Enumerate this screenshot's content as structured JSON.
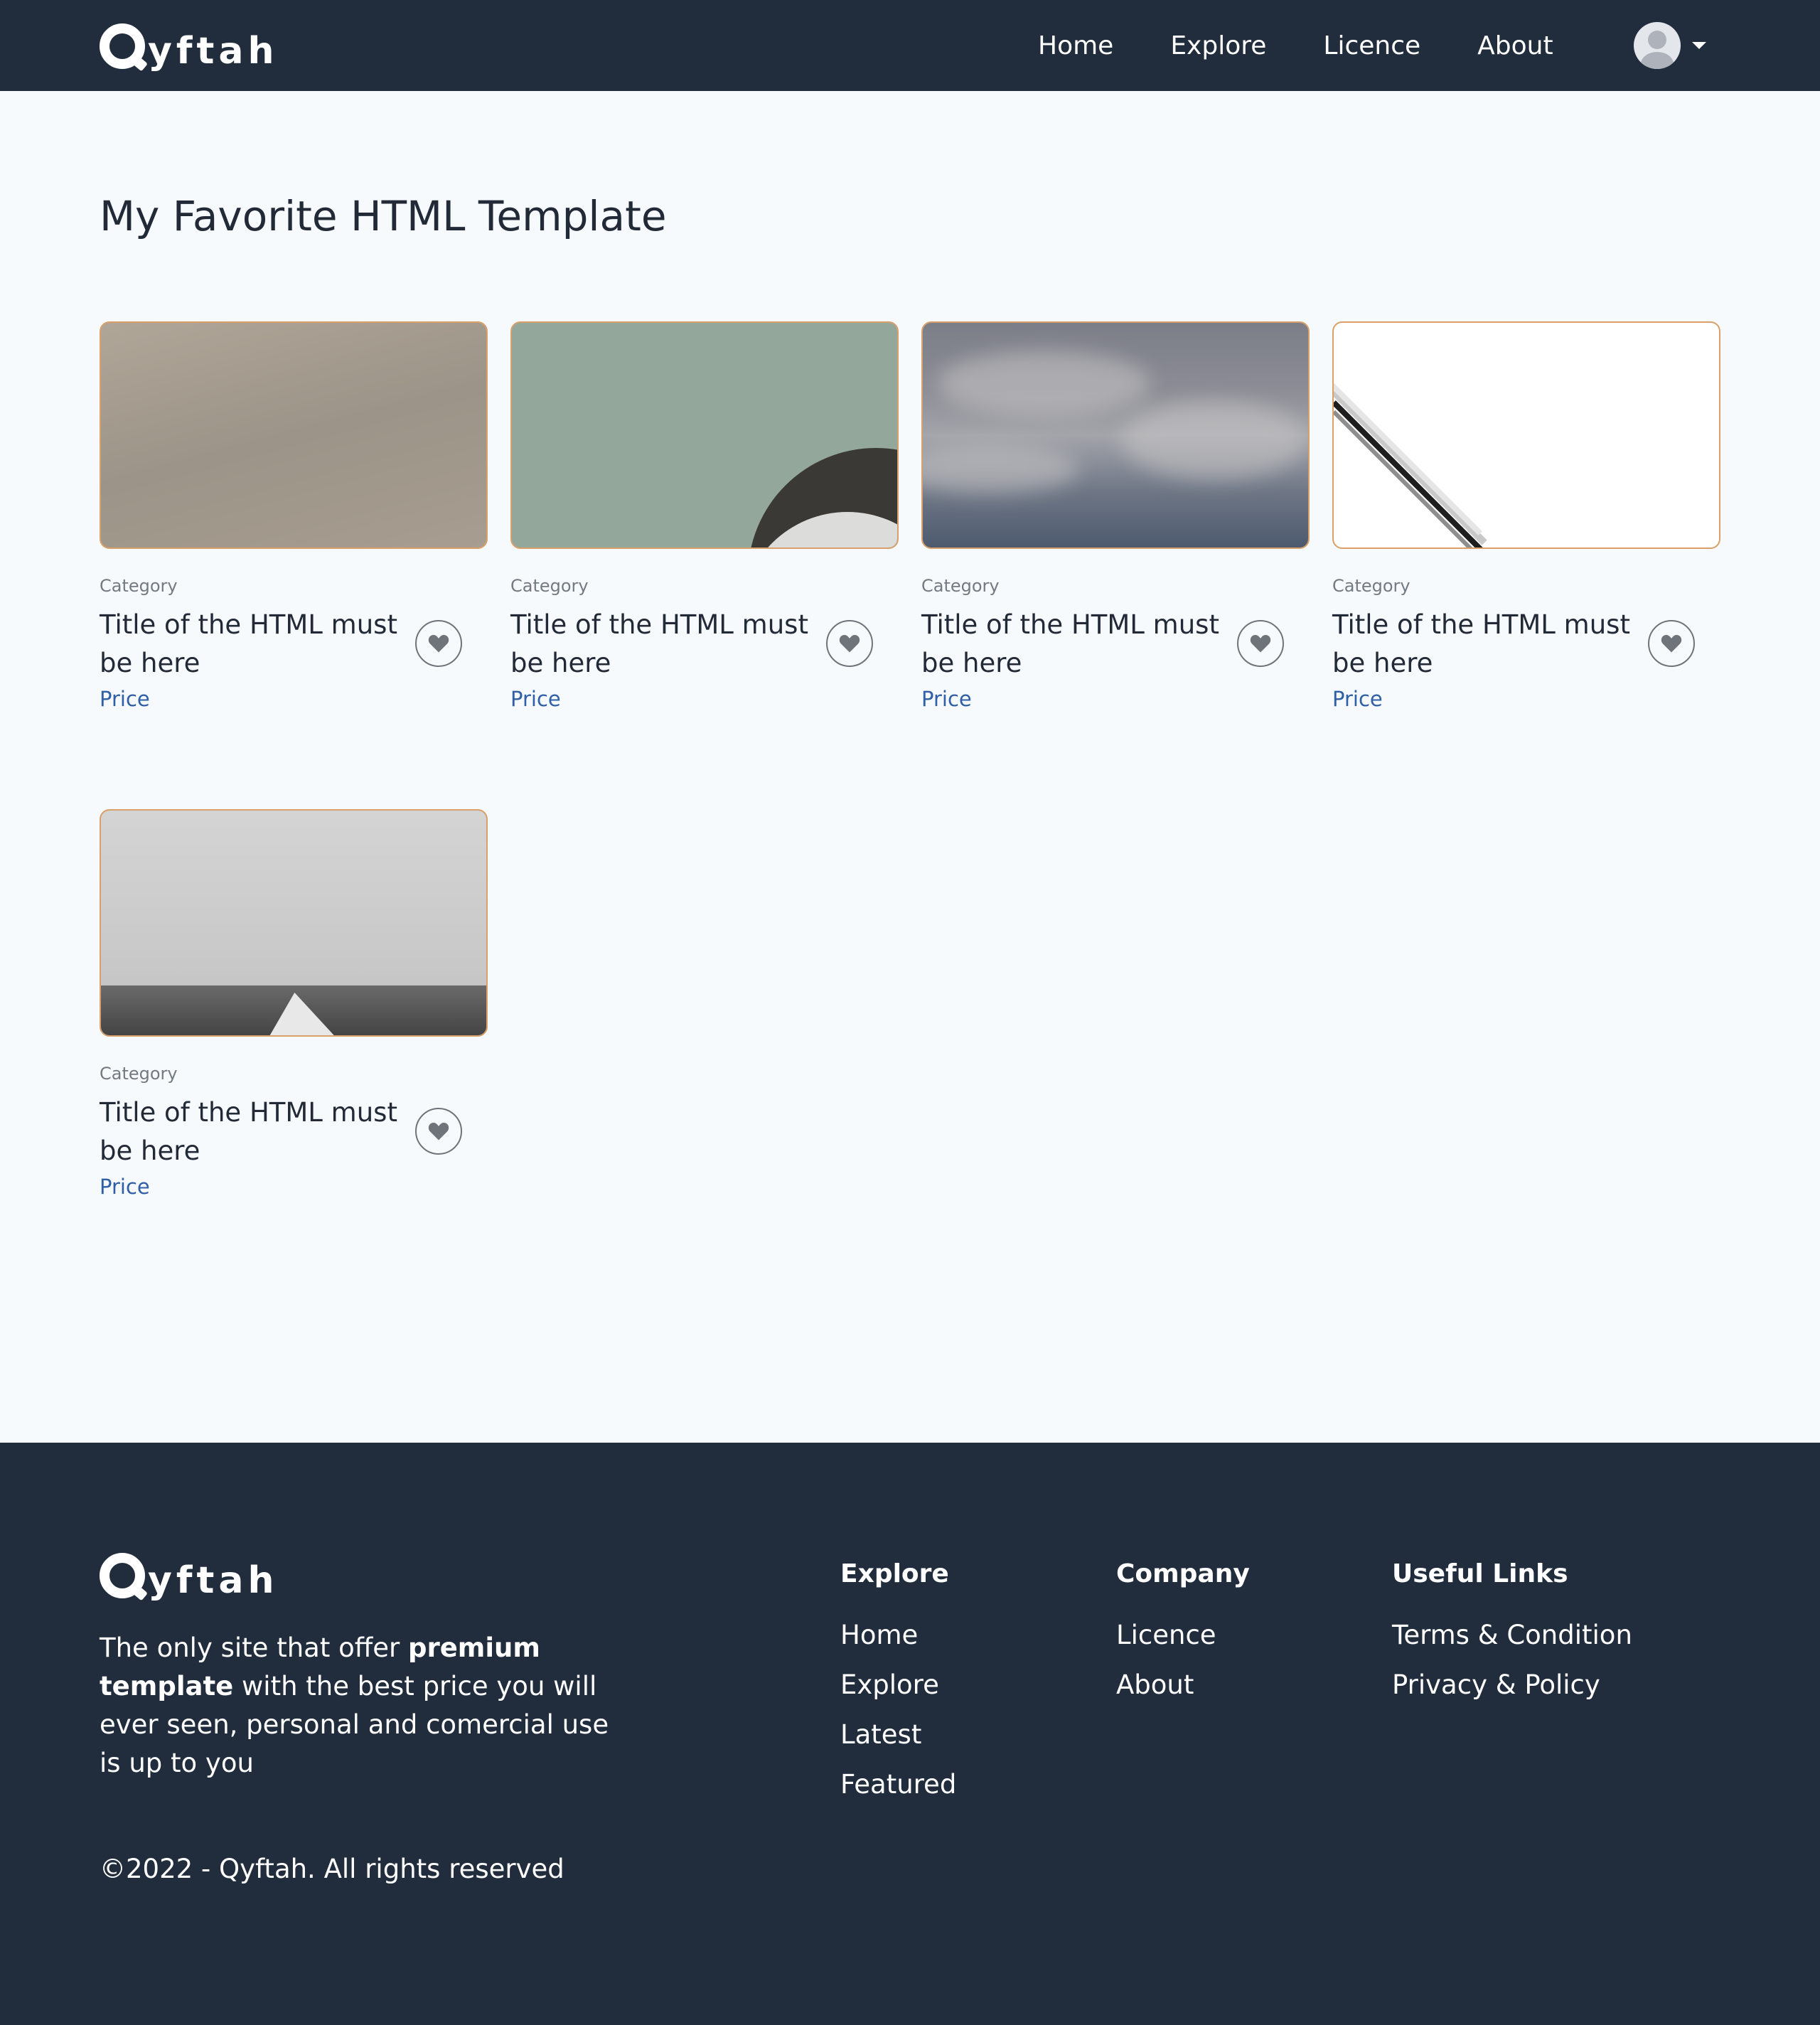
{
  "brand": {
    "name": "yftah",
    "logo_letter": "Q"
  },
  "nav": {
    "links": [
      "Home",
      "Explore",
      "Licence",
      "About"
    ]
  },
  "main": {
    "title": "My Favorite HTML Template",
    "cards": [
      {
        "category": "Category",
        "title": "Title of the HTML must be here",
        "price": "Price"
      },
      {
        "category": "Category",
        "title": "Title of the HTML must be here",
        "price": "Price"
      },
      {
        "category": "Category",
        "title": "Title of the HTML must be here",
        "price": "Price"
      },
      {
        "category": "Category",
        "title": "Title of the HTML must be here",
        "price": "Price"
      },
      {
        "category": "Category",
        "title": "Title of the HTML must be here",
        "price": "Price"
      }
    ]
  },
  "footer": {
    "description_parts": [
      "The only site that offer ",
      "premium template",
      " with the best price you will ever seen, personal and comercial use is up to you"
    ],
    "copyright": "©2022 - Qyftah. All rights reserved",
    "columns": [
      {
        "heading": "Explore",
        "links": [
          "Home",
          "Explore",
          "Latest",
          "Featured"
        ]
      },
      {
        "heading": "Company",
        "links": [
          "Licence",
          "About"
        ]
      },
      {
        "heading": "Useful Links",
        "links": [
          "Terms & Condition",
          "Privacy & Policy"
        ]
      }
    ]
  },
  "colors": {
    "navbar_bg": "#212d3d",
    "page_bg": "#f7fafd",
    "price": "#2f5fa7",
    "thumb_border": "#d9a06a"
  },
  "icons": {
    "favorite": "heart-icon",
    "user": "avatar-icon",
    "dropdown": "caret-down-icon"
  }
}
